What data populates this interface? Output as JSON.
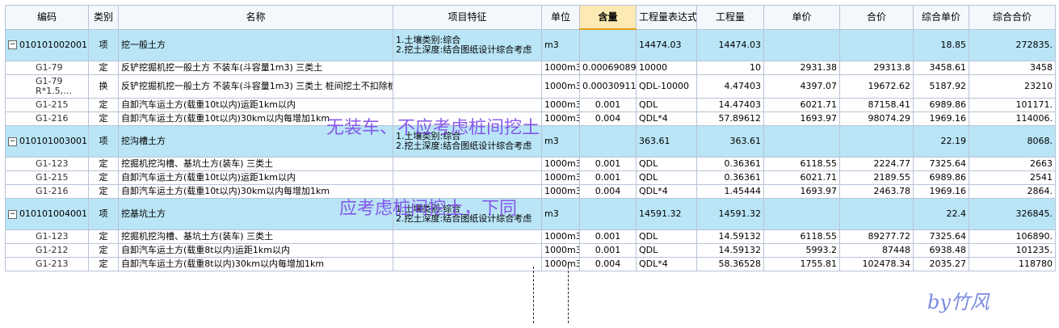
{
  "columns": {
    "code": "编码",
    "type": "类别",
    "name": "名称",
    "feature": "项目特征",
    "unit": "单位",
    "content": "含量",
    "expr": "工程量表达式",
    "qty": "工程量",
    "uprice": "单价",
    "total": "合价",
    "comp_uprice": "综合单价",
    "comp_total": "综合合价"
  },
  "groups": [
    {
      "code": "010101002001",
      "type": "项",
      "name": "挖一般土方",
      "feature": "1.土壤类别:综合\n2.挖土深度:结合图纸设计综合考虑",
      "unit": "m3",
      "content": "",
      "expr": "14474.03",
      "qty": "14474.03",
      "uprice": "",
      "total": "",
      "comp_uprice": "18.85",
      "comp_total": "272835.",
      "children": [
        {
          "code": "G1-79",
          "type": "定",
          "name": "反铲挖掘机挖一般土方 不装车(斗容量1m3) 三类土",
          "feature": "",
          "unit": "1000m3",
          "content": "0.00069089",
          "expr": "10000",
          "qty": "10",
          "uprice": "2931.38",
          "total": "29313.8",
          "comp_uprice": "3458.61",
          "comp_total": "3458"
        },
        {
          "code": "G1-79 R*1.5,…",
          "type": "换",
          "name": "反铲挖掘机挖一般土方 不装车(斗容量1m3) 三类土  桩间挖土不扣除桩体和空孔所占体积 人工*1.5,机械*1.5",
          "feature": "",
          "unit": "1000m3",
          "content": "0.00030911",
          "expr": "QDL-10000",
          "qty": "4.47403",
          "uprice": "4397.07",
          "total": "19672.62",
          "comp_uprice": "5187.92",
          "comp_total": "23210"
        },
        {
          "code": "G1-215",
          "type": "定",
          "name": "自卸汽车运土方(载重10t以内)运距1km以内",
          "feature": "",
          "unit": "1000m3",
          "content": "0.001",
          "expr": "QDL",
          "qty": "14.47403",
          "uprice": "6021.71",
          "total": "87158.41",
          "comp_uprice": "6989.86",
          "comp_total": "101171."
        },
        {
          "code": "G1-216",
          "type": "定",
          "name": "自卸汽车运土方(载重10t以内)30km以内每增加1km",
          "feature": "",
          "unit": "1000m3",
          "content": "0.004",
          "expr": "QDL*4",
          "qty": "57.89612",
          "uprice": "1693.97",
          "total": "98074.29",
          "comp_uprice": "1969.16",
          "comp_total": "114006."
        }
      ]
    },
    {
      "code": "010101003001",
      "type": "项",
      "name": "挖沟槽土方",
      "feature": "1.土壤类别:综合\n2.挖土深度:结合图纸设计综合考虑",
      "unit": "m3",
      "content": "",
      "expr": "363.61",
      "qty": "363.61",
      "uprice": "",
      "total": "",
      "comp_uprice": "22.19",
      "comp_total": "8068.",
      "children": [
        {
          "code": "G1-123",
          "type": "定",
          "name": "挖掘机挖沟槽、基坑土方(装车) 三类土",
          "feature": "",
          "unit": "1000m3",
          "content": "0.001",
          "expr": "QDL",
          "qty": "0.36361",
          "uprice": "6118.55",
          "total": "2224.77",
          "comp_uprice": "7325.64",
          "comp_total": "2663"
        },
        {
          "code": "G1-215",
          "type": "定",
          "name": "自卸汽车运土方(载重10t以内)运距1km以内",
          "feature": "",
          "unit": "1000m3",
          "content": "0.001",
          "expr": "QDL",
          "qty": "0.36361",
          "uprice": "6021.71",
          "total": "2189.55",
          "comp_uprice": "6989.86",
          "comp_total": "2541"
        },
        {
          "code": "G1-216",
          "type": "定",
          "name": "自卸汽车运土方(载重10t以内)30km以内每增加1km",
          "feature": "",
          "unit": "1000m3",
          "content": "0.004",
          "expr": "QDL*4",
          "qty": "1.45444",
          "uprice": "1693.97",
          "total": "2463.78",
          "comp_uprice": "1969.16",
          "comp_total": "2864."
        }
      ]
    },
    {
      "code": "010101004001",
      "type": "项",
      "name": "挖基坑土方",
      "feature": "1.土壤类别:综合\n2.挖土深度:结合图纸设计综合考虑",
      "unit": "m3",
      "content": "",
      "expr": "14591.32",
      "qty": "14591.32",
      "uprice": "",
      "total": "",
      "comp_uprice": "22.4",
      "comp_total": "326845.",
      "children": [
        {
          "code": "G1-123",
          "type": "定",
          "name": "挖掘机挖沟槽、基坑土方(装车) 三类土",
          "feature": "",
          "unit": "1000m3",
          "content": "0.001",
          "expr": "QDL",
          "qty": "14.59132",
          "uprice": "6118.55",
          "total": "89277.72",
          "comp_uprice": "7325.64",
          "comp_total": "106890."
        },
        {
          "code": "G1-212",
          "type": "定",
          "name": "自卸汽车运土方(载重8t以内)运距1km以内",
          "feature": "",
          "unit": "1000m3",
          "content": "0.001",
          "expr": "QDL",
          "qty": "14.59132",
          "uprice": "5993.2",
          "total": "87448",
          "comp_uprice": "6938.48",
          "comp_total": "101235."
        },
        {
          "code": "G1-213",
          "type": "定",
          "name": "自卸汽车运土方(载重8t以内)30km以内每增加1km",
          "feature": "",
          "unit": "1000m3",
          "content": "0.004",
          "expr": "QDL*4",
          "qty": "58.36528",
          "uprice": "1755.81",
          "total": "102478.34",
          "comp_uprice": "2035.27",
          "comp_total": "118780"
        }
      ]
    }
  ],
  "annotations": {
    "note1": "无装车、不应考虑桩间挖土",
    "note2": "应考虑桩间挖土，下同",
    "signature": "by竹风"
  },
  "icons": {
    "expander": "minus-box-icon"
  }
}
